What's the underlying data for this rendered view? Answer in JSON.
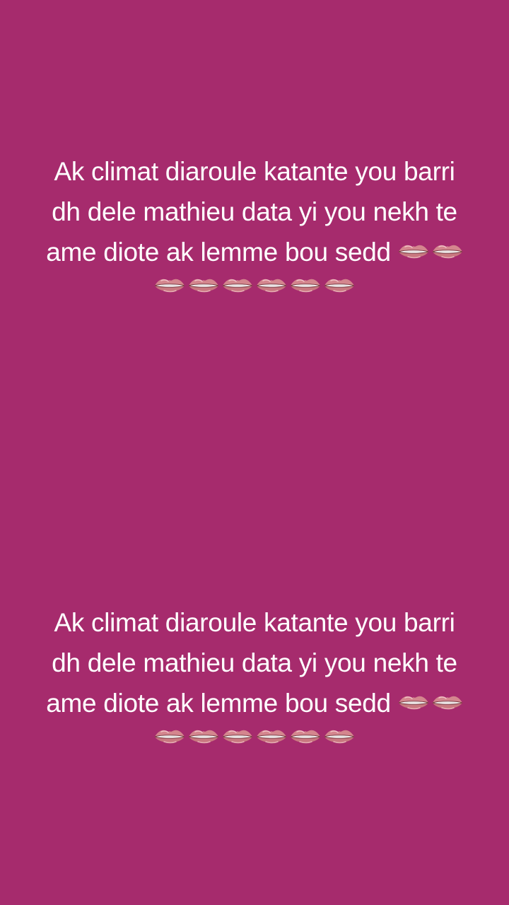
{
  "background_color": "#a62b6d",
  "text_color": "#ffffff",
  "status_top": {
    "line1": "Ak climat diaroule katante you barri",
    "line2": "dh dele mathieu data yi you nekh te",
    "line3": "ame diote ak lemme bou sedd",
    "inline_icons": [
      "lips-icon",
      "lips-icon"
    ],
    "row_icons": [
      "lips-icon",
      "lips-icon",
      "lips-icon",
      "lips-icon",
      "lips-icon",
      "lips-icon"
    ]
  },
  "status_bottom": {
    "line1": "Ak climat diaroule katante you barri",
    "line2": "dh dele mathieu data yi you nekh te",
    "line3": "ame diote ak lemme bou sedd",
    "inline_icons": [
      "lips-icon",
      "lips-icon"
    ],
    "row_icons": [
      "lips-icon",
      "lips-icon",
      "lips-icon",
      "lips-icon",
      "lips-icon",
      "lips-icon"
    ]
  }
}
